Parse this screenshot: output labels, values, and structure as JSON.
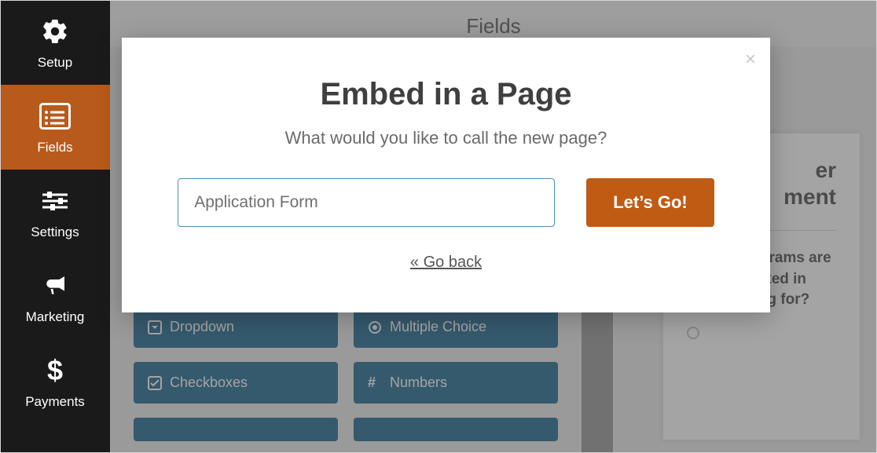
{
  "sidebar": {
    "items": [
      {
        "label": "Setup",
        "icon": "gear-icon"
      },
      {
        "label": "Fields",
        "icon": "list-icon",
        "active": true
      },
      {
        "label": "Settings",
        "icon": "sliders-icon"
      },
      {
        "label": "Marketing",
        "icon": "bullhorn-icon"
      },
      {
        "label": "Payments",
        "icon": "dollar-icon"
      }
    ]
  },
  "header": {
    "title": "Fields"
  },
  "fieldButtons": {
    "dropdown": "Dropdown",
    "multiple": "Multiple Choice",
    "checkboxes": "Checkboxes",
    "numbers": "Numbers"
  },
  "preview": {
    "titleLine1": "er",
    "titleLine2": "ment",
    "question": "Which programs are you interested in volunteering for?"
  },
  "modal": {
    "title": "Embed in a Page",
    "subtitle": "What would you like to call the new page?",
    "inputValue": "Application Form",
    "goLabel": "Let’s Go!",
    "backLabel": "« Go back",
    "closeLabel": "×"
  }
}
